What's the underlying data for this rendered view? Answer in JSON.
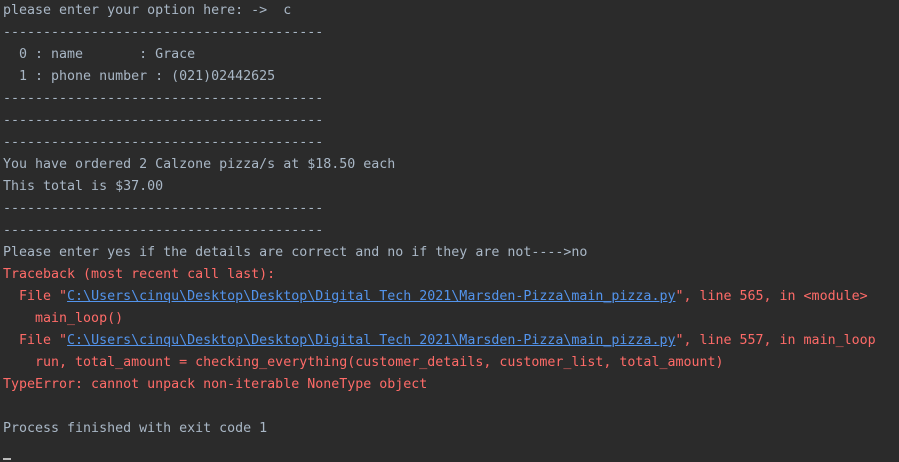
{
  "console": {
    "lines": [
      "please enter your option here: ->  c",
      "----------------------------------------",
      "  0 : name       : Grace",
      "  1 : phone number : (021)02442625",
      "----------------------------------------",
      "----------------------------------------",
      "----------------------------------------",
      "You have ordered 2 Calzone pizza/s at $18.50 each",
      "This total is $37.00",
      "----------------------------------------",
      "----------------------------------------",
      "Please enter yes if the details are correct and no if they are not---->no"
    ],
    "traceback": {
      "header": "Traceback (most recent call last):",
      "frame1": {
        "prefix": "  File \"",
        "path": "C:\\Users\\cinqu\\Desktop\\Desktop\\Digital Tech 2021\\Marsden-Pizza\\main_pizza.py",
        "suffix": "\", line 565, in <module>",
        "code": "    main_loop()"
      },
      "frame2": {
        "prefix": "  File \"",
        "path": "C:\\Users\\cinqu\\Desktop\\Desktop\\Digital Tech 2021\\Marsden-Pizza\\main_pizza.py",
        "suffix": "\", line 557, in main_loop",
        "code": "    run, total_amount = checking_everything(customer_details, customer_list, total_amount)"
      },
      "error": "TypeError: cannot unpack non-iterable NoneType object"
    },
    "finish": "Process finished with exit code 1"
  },
  "colors": {
    "background": "#2b2b2b",
    "text": "#a9b7c6",
    "error": "#ff6b68",
    "link": "#5394ec"
  }
}
